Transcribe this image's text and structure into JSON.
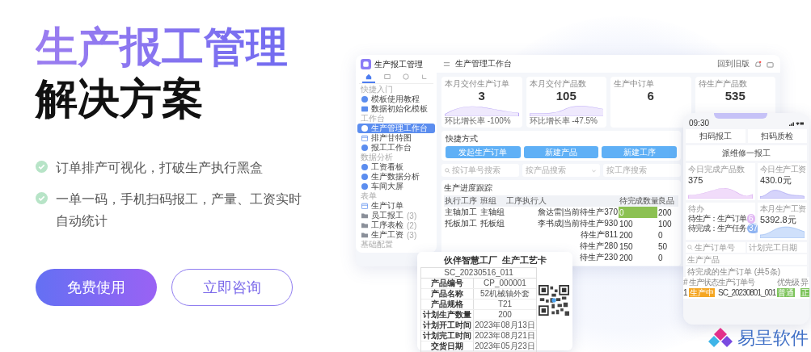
{
  "hero": {
    "title": "生产报工管理",
    "subtitle": "解决方案",
    "features": [
      "订单排产可视化，打破生产执行黑盒",
      "一单一码，手机扫码报工，产量、工资实时自动统计"
    ],
    "buttons": [
      {
        "label": "免费使用",
        "kind": "primary"
      },
      {
        "label": "立即咨询",
        "kind": "outline"
      }
    ]
  },
  "app": {
    "name": "生产报工管理",
    "nav_tabs": [
      {
        "selected": true
      },
      {
        "selected": false
      },
      {
        "selected": false
      },
      {
        "selected": false
      }
    ],
    "sidebar": [
      {
        "heading": "快捷入门",
        "items": [
          {
            "label": "模板使用教程",
            "kind": "page",
            "selected": false
          },
          {
            "label": "数据初始化模板",
            "kind": "grid",
            "selected": false
          }
        ]
      },
      {
        "heading": "工作台",
        "items": [
          {
            "label": "生产管理工作台",
            "kind": "page",
            "selected": true
          },
          {
            "label": "排产甘特图",
            "kind": "calendar",
            "selected": false
          },
          {
            "label": "报工工作台",
            "kind": "page",
            "selected": false
          }
        ]
      },
      {
        "heading": "数据分析",
        "items": [
          {
            "label": "工资看板",
            "kind": "page",
            "selected": false
          },
          {
            "label": "生产数据分析",
            "kind": "page",
            "selected": false
          },
          {
            "label": "车间大屏",
            "kind": "page",
            "selected": false
          }
        ]
      },
      {
        "heading": "表单",
        "items": [
          {
            "label": "生产订单",
            "kind": "calendar",
            "selected": false
          },
          {
            "label": "员工报工",
            "count": "(3)",
            "kind": "folder",
            "selected": false
          },
          {
            "label": "工序表检",
            "count": "(2)",
            "kind": "folder",
            "selected": false
          },
          {
            "label": "生产工资",
            "count": "(3)",
            "kind": "folder",
            "selected": false
          }
        ]
      },
      {
        "heading": "基础配置"
      }
    ],
    "topbar": {
      "title": "生产管理工作台",
      "action": "回到旧版"
    },
    "stats": [
      {
        "label": "本月交付生产订单",
        "value": "3",
        "trend": "环比增长率 -100%"
      },
      {
        "label": "本月交付产品数",
        "value": "105",
        "trend": "环比增长率 -47.5%"
      },
      {
        "label": "生产中订单",
        "value": "6"
      },
      {
        "label": "待生产产品数",
        "value": "535"
      }
    ],
    "shortcuts": {
      "title": "快捷方式",
      "buttons": [
        "发起生产订单",
        "新建产品",
        "新建工序"
      ]
    },
    "filters": [
      {
        "placeholder": "按订单号搜索",
        "kind": "search"
      },
      {
        "placeholder": "按产品搜索",
        "kind": "select"
      },
      {
        "placeholder": "按工序搜索",
        "kind": "text"
      }
    ],
    "progress": {
      "title": "生产进度跟踪",
      "columns": [
        "执行工序",
        "班组",
        "工序执行人",
        "待完成数量",
        "良品"
      ],
      "rows": [
        {
          "process": "主轴加工",
          "team": "主轴组",
          "assignee": "詹达雷|当前待生产370",
          "remaining": "0",
          "good": "200",
          "flagged": true
        },
        {
          "process": "托板加工",
          "team": "托板组",
          "assignee": "李书成|当前待生产930",
          "remaining": "100",
          "good": "100",
          "flagged": false
        },
        {
          "assignee": "待生产811",
          "remaining": "200",
          "good": "0",
          "flagged": false
        },
        {
          "assignee": "待生产280",
          "remaining": "150",
          "good": "50",
          "flagged": false
        },
        {
          "assignee": "待生产230",
          "remaining": "200",
          "good": "0",
          "flagged": false
        }
      ]
    }
  },
  "card": {
    "company": "伙伴智慧工厂",
    "title": "生产工艺卡",
    "code": "SC_20230516_011",
    "rows": [
      {
        "label": "产品编号",
        "value": "CP_000001"
      },
      {
        "label": "产品名称",
        "value": "52机械轴外套"
      },
      {
        "label": "产品规格",
        "value": "T21"
      },
      {
        "label": "计划生产数量",
        "value": "200"
      },
      {
        "label": "计划开工时间",
        "value": "2023年08月13日"
      },
      {
        "label": "计划完工时间",
        "value": "2023年08月21日"
      },
      {
        "label": "交货日期",
        "value": "2023年05月23日"
      }
    ]
  },
  "phone": {
    "time": "09:30",
    "tiles": [
      "扫码报工",
      "扫码质检"
    ],
    "banner": "派维修一报工",
    "stats": [
      {
        "label": "今日完成产品数",
        "value": "375"
      },
      {
        "label": "今日生产工资",
        "value": "430.0元"
      }
    ],
    "todo": {
      "title": "待办",
      "items": [
        {
          "label": "待生产：生产订单",
          "count": "6"
        },
        {
          "label": "待完成：生产任务",
          "count": "37"
        }
      ]
    },
    "monthly": {
      "label": "本月生产工资",
      "value": "5392.8元"
    },
    "fields": [
      {
        "placeholder": "生产订单号",
        "kind": "search"
      },
      {
        "placeholder": "计划完工日期",
        "kind": "select"
      },
      {
        "placeholder": "生产产品",
        "kind": "select"
      }
    ],
    "list_title": "待完成的生产订单 (共5条)",
    "columns": [
      "#",
      "生产状态",
      "生产订单号",
      "优先级",
      "异"
    ],
    "rows": [
      {
        "index": "1",
        "status": "生产中",
        "order": "SC_20230801_001",
        "priority": "普通",
        "exception": "正"
      }
    ]
  },
  "logo": {
    "name": "易呈软件"
  }
}
